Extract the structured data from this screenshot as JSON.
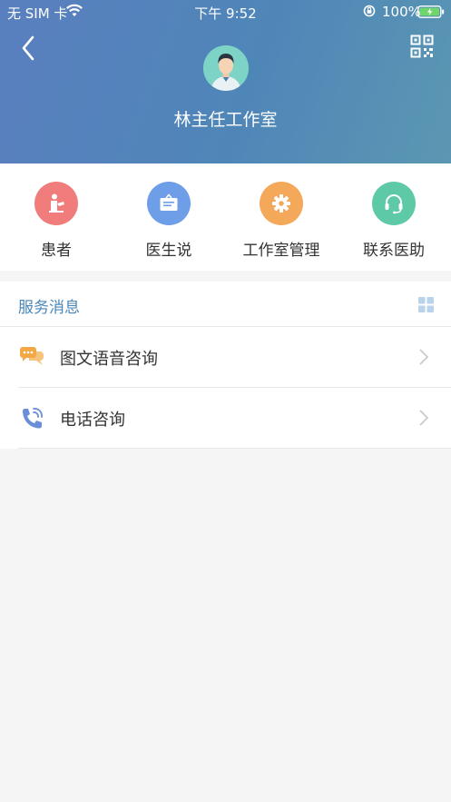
{
  "status_bar": {
    "carrier": "无 SIM 卡",
    "time": "下午 9:52",
    "battery": "100%"
  },
  "header": {
    "title": "林主任工作室",
    "gradient_start": "#5a7fbf",
    "gradient_end": "#5b97b2"
  },
  "quick_actions": [
    {
      "label": "患者",
      "icon": "patient-icon",
      "color": "#f07d7b"
    },
    {
      "label": "医生说",
      "icon": "doctor-says-icon",
      "color": "#6f9ee8"
    },
    {
      "label": "工作室管理",
      "icon": "gear-icon",
      "color": "#f4a85a"
    },
    {
      "label": "联系医助",
      "icon": "headset-icon",
      "color": "#5ec9a6"
    }
  ],
  "service_messages": {
    "title": "服务消息",
    "items": [
      {
        "label": "图文语音咨询",
        "icon": "chat-bubbles-icon"
      },
      {
        "label": "电话咨询",
        "icon": "phone-icon"
      }
    ]
  }
}
